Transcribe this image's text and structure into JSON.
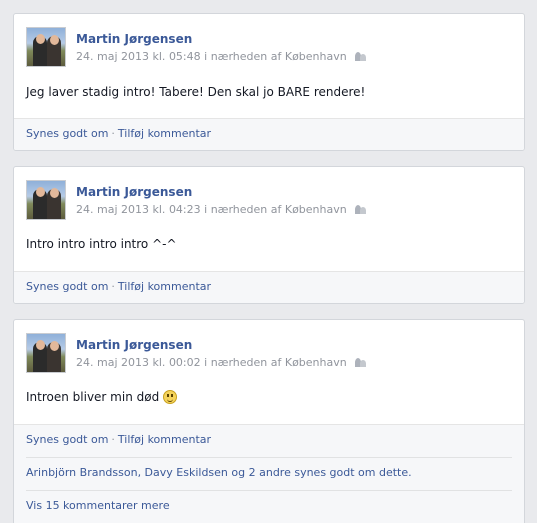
{
  "posts": [
    {
      "author": "Martin Jørgensen",
      "date": "24. maj 2013",
      "time_prefix": "kl.",
      "time": "05:48",
      "location": "i nærheden af København",
      "text": "Jeg laver stadig intro! Tabere! Den skal jo BARE rendere!",
      "like_label": "Synes godt om",
      "comment_label": "Tilføj kommentar"
    },
    {
      "author": "Martin Jørgensen",
      "date": "24. maj 2013",
      "time_prefix": "kl.",
      "time": "04:23",
      "location": "i nærheden af København",
      "text": "Intro intro intro intro ^-^",
      "like_label": "Synes godt om",
      "comment_label": "Tilføj kommentar"
    },
    {
      "author": "Martin Jørgensen",
      "date": "24. maj 2013",
      "time_prefix": "kl.",
      "time": "00:02",
      "location": "i nærheden af København",
      "text": "Introen bliver min død",
      "emoji": "smiley-icon",
      "like_label": "Synes godt om",
      "comment_label": "Tilføj kommentar",
      "likes_text": "Arinbjörn Brandsson, Davy Eskildsen og 2 andre synes godt om dette.",
      "more_comments": "Vis 15 kommentarer mere"
    }
  ],
  "colors": {
    "link": "#3b5998",
    "meta": "#90949c",
    "background": "#e9eaed"
  }
}
